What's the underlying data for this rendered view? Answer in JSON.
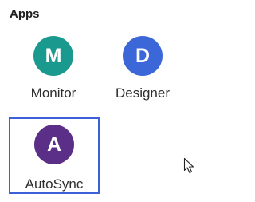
{
  "section": {
    "title": "Apps"
  },
  "apps": [
    {
      "name": "Monitor",
      "initial": "M",
      "color": "#1a9a8e",
      "selected": false
    },
    {
      "name": "Designer",
      "initial": "D",
      "color": "#3b67d8",
      "selected": false
    },
    {
      "name": "AutoSync",
      "initial": "A",
      "color": "#5b2f87",
      "selected": true
    }
  ],
  "colors": {
    "selection_border": "#3d5fd9",
    "text": "#2e2e2e"
  },
  "cursor": {
    "icon": "mouse-pointer-icon"
  }
}
